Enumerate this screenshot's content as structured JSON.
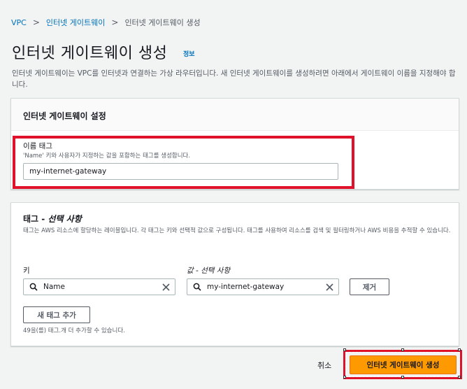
{
  "breadcrumb": {
    "items": [
      "VPC",
      "인터넷 게이트웨이",
      "인터넷 게이트웨이 생성"
    ]
  },
  "header": {
    "title": "인터넷 게이트웨이 생성",
    "info_link": "정보",
    "description": "인터넷 게이트웨이는 VPC를 인터넷과 연결하는 가상 라우터입니다. 새 인터넷 게이트웨이를 생성하려면 아래에서 게이트웨이 이름을 지정해야 합니다."
  },
  "settings_panel": {
    "title": "인터넷 게이트웨이 설정",
    "name_tag_label": "이름 태그",
    "name_tag_desc": "'Name' 키와 사용자가 지정하는 값을 포함하는 태그를 생성합니다.",
    "name_tag_value": "my-internet-gateway"
  },
  "tags_panel": {
    "title_main": "태그 - ",
    "title_optional": "선택 사항",
    "description": "태그는 AWS 리소스에 할당하는 레이블입니다. 각 태그는 키와 선택적 값으로 구성됩니다. 태그를 사용하여 리소스를 검색 및 필터링하거나 AWS 비용을 추적할 수 있습니다.",
    "key_label": "키",
    "value_label": "값 - 선택 사항",
    "key_value": "Name",
    "value_value": "my-internet-gateway",
    "remove_button": "제거",
    "add_tag_button": "새 태그 추가",
    "remaining_note": "49을(를) 태그.개 더 추가할 수 있습니다."
  },
  "footer": {
    "cancel": "취소",
    "create": "인터넷 게이트웨이 생성"
  },
  "colors": {
    "primary": "#ff9900",
    "link": "#0073bb",
    "highlight": "#e0112b"
  }
}
